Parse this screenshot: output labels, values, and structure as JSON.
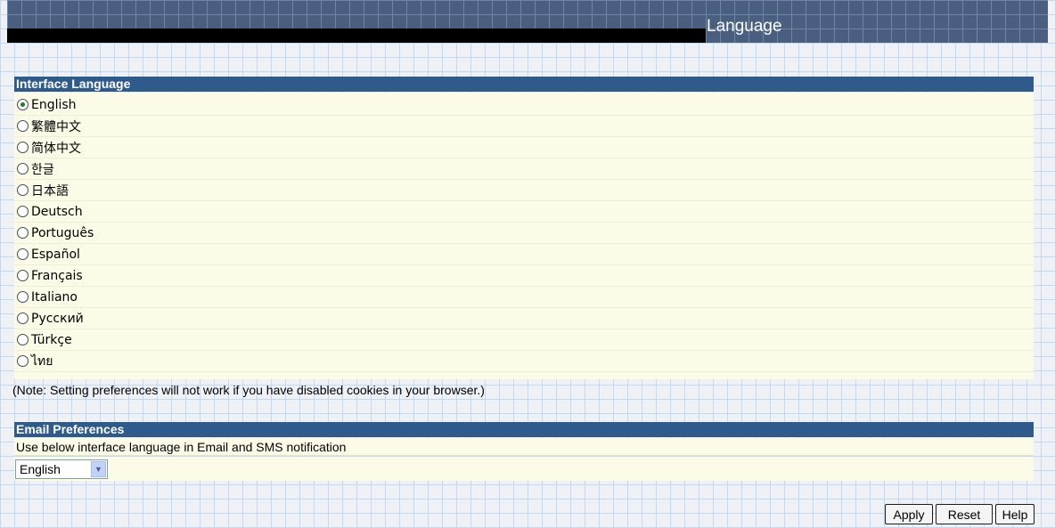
{
  "header": {
    "title": "Language"
  },
  "interface_language": {
    "section_title": "Interface Language",
    "options": [
      {
        "label": "English",
        "checked": true
      },
      {
        "label": "繁體中文",
        "checked": false
      },
      {
        "label": "简体中文",
        "checked": false
      },
      {
        "label": "한글",
        "checked": false
      },
      {
        "label": "日本語",
        "checked": false
      },
      {
        "label": "Deutsch",
        "checked": false
      },
      {
        "label": "Português",
        "checked": false
      },
      {
        "label": "Español",
        "checked": false
      },
      {
        "label": "Français",
        "checked": false
      },
      {
        "label": "Italiano",
        "checked": false
      },
      {
        "label": "Русский",
        "checked": false
      },
      {
        "label": "Türkçe",
        "checked": false
      },
      {
        "label": "ไทย",
        "checked": false
      }
    ],
    "note": "(Note: Setting preferences will not work if you have disabled cookies in your browser.)"
  },
  "email_preferences": {
    "section_title": "Email Preferences",
    "description": "Use below interface language in Email and SMS notification",
    "selected_language": "English"
  },
  "buttons": {
    "apply": "Apply",
    "reset": "Reset",
    "help": "Help"
  },
  "colors": {
    "section_header_bg": "#2e5a8c",
    "panel_bg": "#fbfbe8",
    "header_band": "#4a5f80"
  }
}
